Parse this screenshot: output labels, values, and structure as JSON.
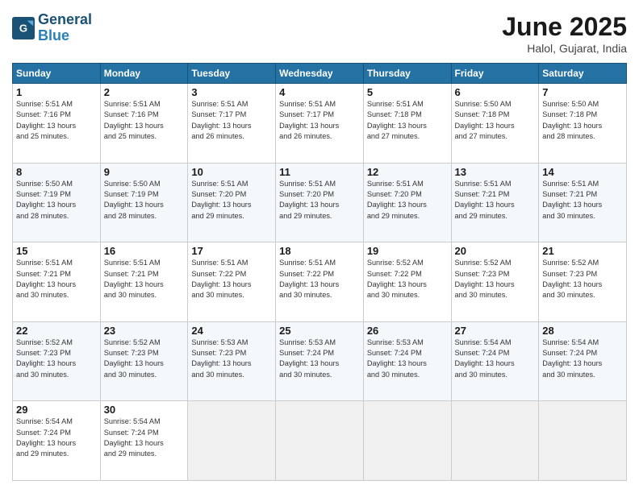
{
  "logo": {
    "line1": "General",
    "line2": "Blue"
  },
  "title": "June 2025",
  "location": "Halol, Gujarat, India",
  "days_of_week": [
    "Sunday",
    "Monday",
    "Tuesday",
    "Wednesday",
    "Thursday",
    "Friday",
    "Saturday"
  ],
  "weeks": [
    [
      {
        "day": "1",
        "info": "Sunrise: 5:51 AM\nSunset: 7:16 PM\nDaylight: 13 hours\nand 25 minutes."
      },
      {
        "day": "2",
        "info": "Sunrise: 5:51 AM\nSunset: 7:16 PM\nDaylight: 13 hours\nand 25 minutes."
      },
      {
        "day": "3",
        "info": "Sunrise: 5:51 AM\nSunset: 7:17 PM\nDaylight: 13 hours\nand 26 minutes."
      },
      {
        "day": "4",
        "info": "Sunrise: 5:51 AM\nSunset: 7:17 PM\nDaylight: 13 hours\nand 26 minutes."
      },
      {
        "day": "5",
        "info": "Sunrise: 5:51 AM\nSunset: 7:18 PM\nDaylight: 13 hours\nand 27 minutes."
      },
      {
        "day": "6",
        "info": "Sunrise: 5:50 AM\nSunset: 7:18 PM\nDaylight: 13 hours\nand 27 minutes."
      },
      {
        "day": "7",
        "info": "Sunrise: 5:50 AM\nSunset: 7:18 PM\nDaylight: 13 hours\nand 28 minutes."
      }
    ],
    [
      {
        "day": "8",
        "info": "Sunrise: 5:50 AM\nSunset: 7:19 PM\nDaylight: 13 hours\nand 28 minutes."
      },
      {
        "day": "9",
        "info": "Sunrise: 5:50 AM\nSunset: 7:19 PM\nDaylight: 13 hours\nand 28 minutes."
      },
      {
        "day": "10",
        "info": "Sunrise: 5:51 AM\nSunset: 7:20 PM\nDaylight: 13 hours\nand 29 minutes."
      },
      {
        "day": "11",
        "info": "Sunrise: 5:51 AM\nSunset: 7:20 PM\nDaylight: 13 hours\nand 29 minutes."
      },
      {
        "day": "12",
        "info": "Sunrise: 5:51 AM\nSunset: 7:20 PM\nDaylight: 13 hours\nand 29 minutes."
      },
      {
        "day": "13",
        "info": "Sunrise: 5:51 AM\nSunset: 7:21 PM\nDaylight: 13 hours\nand 29 minutes."
      },
      {
        "day": "14",
        "info": "Sunrise: 5:51 AM\nSunset: 7:21 PM\nDaylight: 13 hours\nand 30 minutes."
      }
    ],
    [
      {
        "day": "15",
        "info": "Sunrise: 5:51 AM\nSunset: 7:21 PM\nDaylight: 13 hours\nand 30 minutes."
      },
      {
        "day": "16",
        "info": "Sunrise: 5:51 AM\nSunset: 7:21 PM\nDaylight: 13 hours\nand 30 minutes."
      },
      {
        "day": "17",
        "info": "Sunrise: 5:51 AM\nSunset: 7:22 PM\nDaylight: 13 hours\nand 30 minutes."
      },
      {
        "day": "18",
        "info": "Sunrise: 5:51 AM\nSunset: 7:22 PM\nDaylight: 13 hours\nand 30 minutes."
      },
      {
        "day": "19",
        "info": "Sunrise: 5:52 AM\nSunset: 7:22 PM\nDaylight: 13 hours\nand 30 minutes."
      },
      {
        "day": "20",
        "info": "Sunrise: 5:52 AM\nSunset: 7:23 PM\nDaylight: 13 hours\nand 30 minutes."
      },
      {
        "day": "21",
        "info": "Sunrise: 5:52 AM\nSunset: 7:23 PM\nDaylight: 13 hours\nand 30 minutes."
      }
    ],
    [
      {
        "day": "22",
        "info": "Sunrise: 5:52 AM\nSunset: 7:23 PM\nDaylight: 13 hours\nand 30 minutes."
      },
      {
        "day": "23",
        "info": "Sunrise: 5:52 AM\nSunset: 7:23 PM\nDaylight: 13 hours\nand 30 minutes."
      },
      {
        "day": "24",
        "info": "Sunrise: 5:53 AM\nSunset: 7:23 PM\nDaylight: 13 hours\nand 30 minutes."
      },
      {
        "day": "25",
        "info": "Sunrise: 5:53 AM\nSunset: 7:24 PM\nDaylight: 13 hours\nand 30 minutes."
      },
      {
        "day": "26",
        "info": "Sunrise: 5:53 AM\nSunset: 7:24 PM\nDaylight: 13 hours\nand 30 minutes."
      },
      {
        "day": "27",
        "info": "Sunrise: 5:54 AM\nSunset: 7:24 PM\nDaylight: 13 hours\nand 30 minutes."
      },
      {
        "day": "28",
        "info": "Sunrise: 5:54 AM\nSunset: 7:24 PM\nDaylight: 13 hours\nand 30 minutes."
      }
    ],
    [
      {
        "day": "29",
        "info": "Sunrise: 5:54 AM\nSunset: 7:24 PM\nDaylight: 13 hours\nand 29 minutes."
      },
      {
        "day": "30",
        "info": "Sunrise: 5:54 AM\nSunset: 7:24 PM\nDaylight: 13 hours\nand 29 minutes."
      },
      {
        "day": "",
        "info": ""
      },
      {
        "day": "",
        "info": ""
      },
      {
        "day": "",
        "info": ""
      },
      {
        "day": "",
        "info": ""
      },
      {
        "day": "",
        "info": ""
      }
    ]
  ]
}
